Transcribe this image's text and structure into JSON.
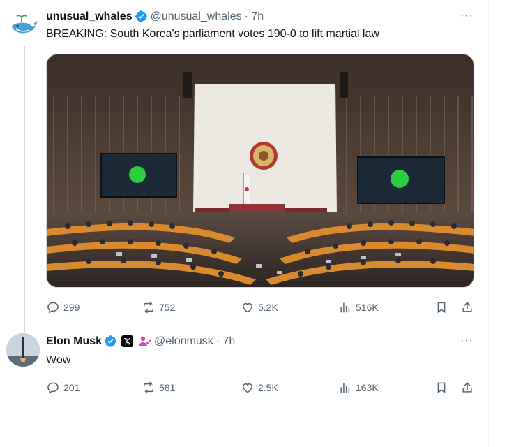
{
  "colors": {
    "verified": "#1d9bf0",
    "text_secondary": "#536471",
    "affiliate": "#c34bb5"
  },
  "tweet": {
    "author_name": "unusual_whales",
    "handle": "@unusual_whales",
    "time": "· 7h",
    "more_label": "···",
    "text": "BREAKING: South Korea's parliament votes 190-0 to lift martial law",
    "media_alt": "South Korean National Assembly plenary chamber during vote",
    "stats": {
      "replies": "299",
      "reposts": "752",
      "likes": "5.2K",
      "views": "516K"
    }
  },
  "reply": {
    "author_name": "Elon Musk",
    "badge_x": "𝕏",
    "handle": "@elonmusk",
    "time": "· 7h",
    "more_label": "···",
    "text": "Wow",
    "stats": {
      "replies": "201",
      "reposts": "581",
      "likes": "2.5K",
      "views": "163K"
    }
  },
  "icons": [
    "reply-icon",
    "repost-icon",
    "like-icon",
    "views-icon",
    "bookmark-icon",
    "share-icon",
    "verified-icon",
    "more-icon"
  ]
}
